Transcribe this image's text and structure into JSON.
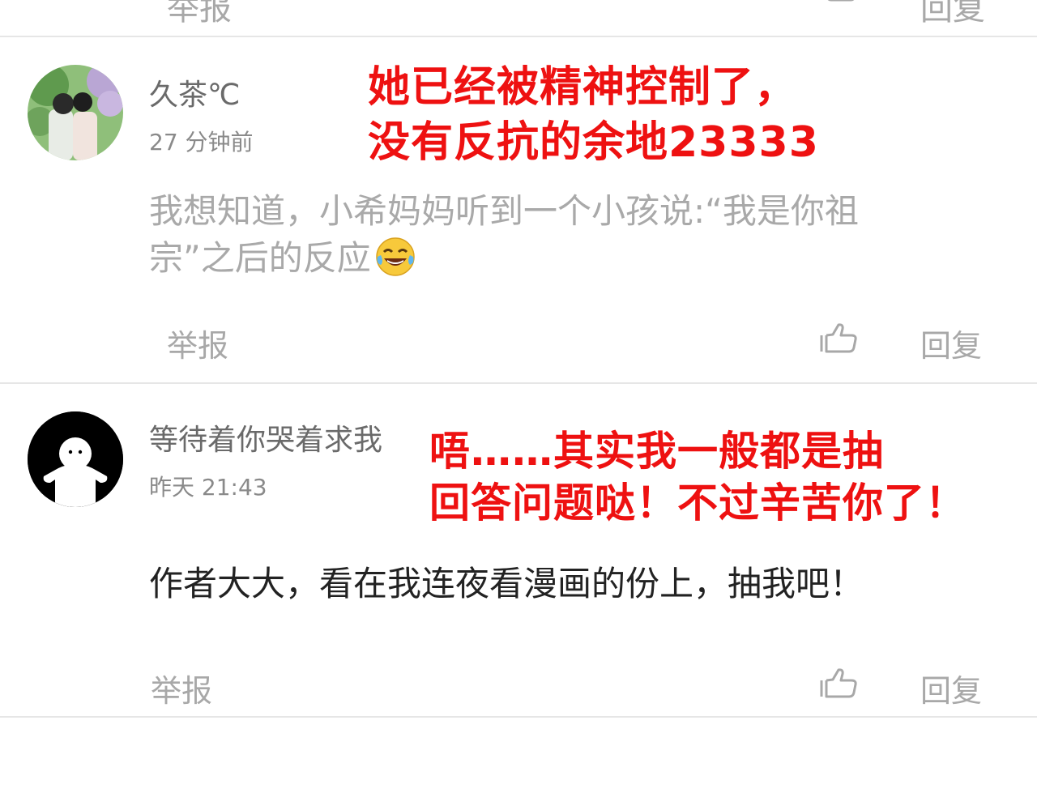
{
  "top_partial": {
    "report_label": "举报",
    "reply_label": "回复"
  },
  "comments": [
    {
      "username": "久茶℃",
      "time": "27 分钟前",
      "text_line1": "我想知道，小希妈妈听到一个小孩说:“我是你祖",
      "text_line2": "宗”之后的反应",
      "emoji": "tears-of-joy-emoji",
      "report_label": "举报",
      "reply_label": "回复",
      "overlay_line1": "她已经被精神控制了，",
      "overlay_line2": "没有反抗的余地23333"
    },
    {
      "username": "等待着你哭着求我",
      "time": "昨天 21:43",
      "text": "作者大大，看在我连夜看漫画的份上，抽我吧！",
      "report_label": "举报",
      "reply_label": "回复",
      "overlay_line1": "唔……其实我一般都是抽",
      "overlay_line2": "回答问题哒！不过辛苦你了！"
    }
  ],
  "colors": {
    "overlay_red": "#ee1111",
    "divider": "#e6e6e6",
    "muted_text": "#a8a8a8"
  }
}
